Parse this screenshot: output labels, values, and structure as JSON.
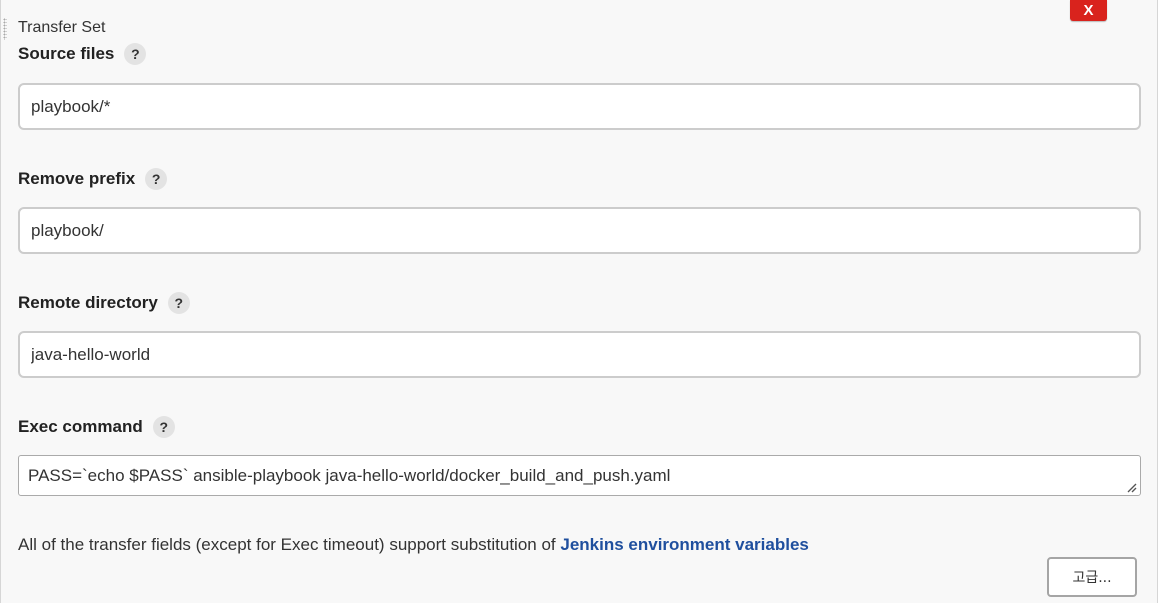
{
  "transfer_set": {
    "title": "Transfer Set",
    "delete_label": "X"
  },
  "fields": {
    "source_files": {
      "label": "Source files",
      "help": "?",
      "value": "playbook/*"
    },
    "remove_prefix": {
      "label": "Remove prefix",
      "help": "?",
      "value": "playbook/"
    },
    "remote_directory": {
      "label": "Remote directory",
      "help": "?",
      "value": "java-hello-world"
    },
    "exec_command": {
      "label": "Exec command",
      "help": "?",
      "value": "PASS=`echo $PASS` ansible-playbook java-hello-world/docker_build_and_push.yaml"
    }
  },
  "note": {
    "text": "All of the transfer fields (except for Exec timeout) support substitution of ",
    "link": "Jenkins environment variables"
  },
  "advanced_button": {
    "label": "고급..."
  },
  "colors": {
    "delete_button": "#d9231d",
    "link": "#1f4f9e",
    "background": "#f8f8f8"
  }
}
